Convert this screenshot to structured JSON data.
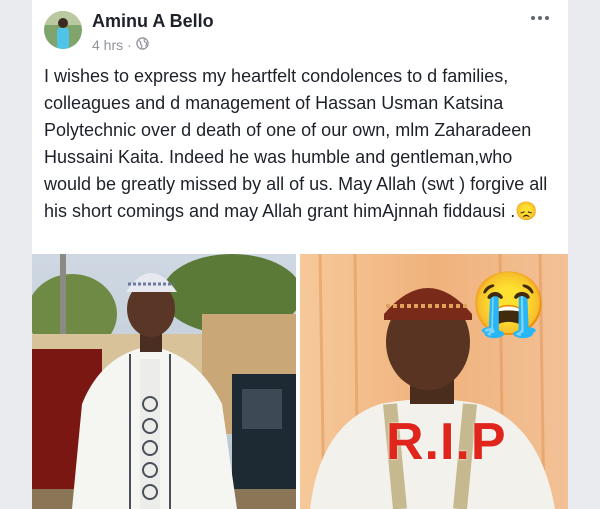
{
  "post": {
    "author": "Aminu A Bello",
    "time": "4 hrs",
    "separator": "·",
    "audience_icon": "globe-icon",
    "text": "I wishes to express my heartfelt condolences to d families, colleagues and d management of Hassan Usman Katsina Polytechnic over d death of one of our own, mlm Zaharadeen Hussaini Kaita. Indeed he was humble and gentleman,who would be greatly missed by all of us. May Allah (swt ) forgive all his short comings and may Allah grant himAjnnah fiddausi .",
    "emoji": "😞"
  },
  "photos": {
    "right_overlay_text": "R.I.P",
    "right_emoji": "😭"
  },
  "colors": {
    "author": "#1d2129",
    "meta": "#90949c",
    "rip": "#e0251c"
  }
}
